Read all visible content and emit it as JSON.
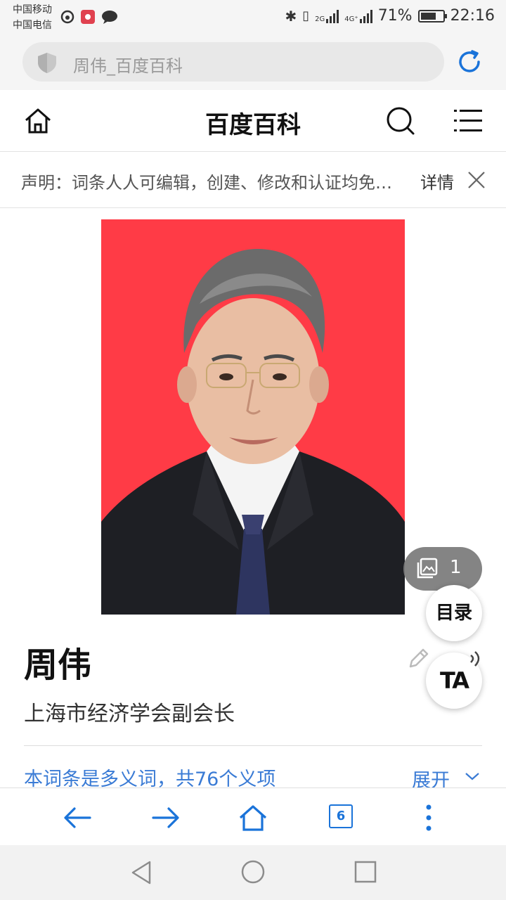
{
  "status_bar": {
    "carrier_1": "中国移动",
    "carrier_2": "中国电信",
    "network_1": "2G",
    "network_2": "4G⁺",
    "battery_percent": "71%",
    "battery_level": 0.71,
    "time": "22:16"
  },
  "address_bar": {
    "url_text": "周伟_百度百科"
  },
  "header": {
    "title": "百度百科"
  },
  "notice": {
    "text": "声明：词条人人可编辑，创建、修改和认证均免…",
    "detail_label": "详情"
  },
  "floating": {
    "gallery_count": "1",
    "toc_label": "目录",
    "ta_label": "TA"
  },
  "article": {
    "name": "周伟",
    "subtitle": "上海市经济学会副会长",
    "polysemy_text": "本词条是多义词，共76个义项",
    "expand_label": "展开"
  },
  "toolbar": {
    "tab_count": "6"
  },
  "colors": {
    "accent_blue": "#1a73d9",
    "link_blue": "#3a7bd5",
    "photo_background": "#ff3b46"
  }
}
